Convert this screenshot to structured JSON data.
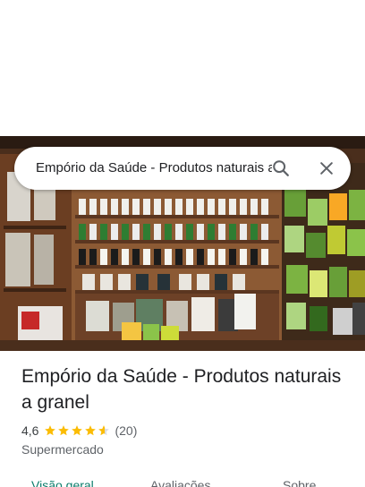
{
  "search": {
    "query": "Empório da Saúde - Produtos naturais a granel"
  },
  "place": {
    "title": "Empório da Saúde - Produtos naturais a granel",
    "rating": "4,6",
    "stars_value": 4.6,
    "stars_max": 5,
    "review_count": "(20)",
    "category": "Supermercado"
  },
  "tabs": [
    {
      "label": "Visão geral",
      "active": true
    },
    {
      "label": "Avaliações",
      "active": false
    },
    {
      "label": "Sobre",
      "active": false
    }
  ],
  "colors": {
    "accent": "#0b7d6b",
    "star": "#fbbc04",
    "star_empty": "#dadce0"
  },
  "icons": {
    "search": "search-icon",
    "close": "close-icon",
    "star": "star-icon"
  }
}
